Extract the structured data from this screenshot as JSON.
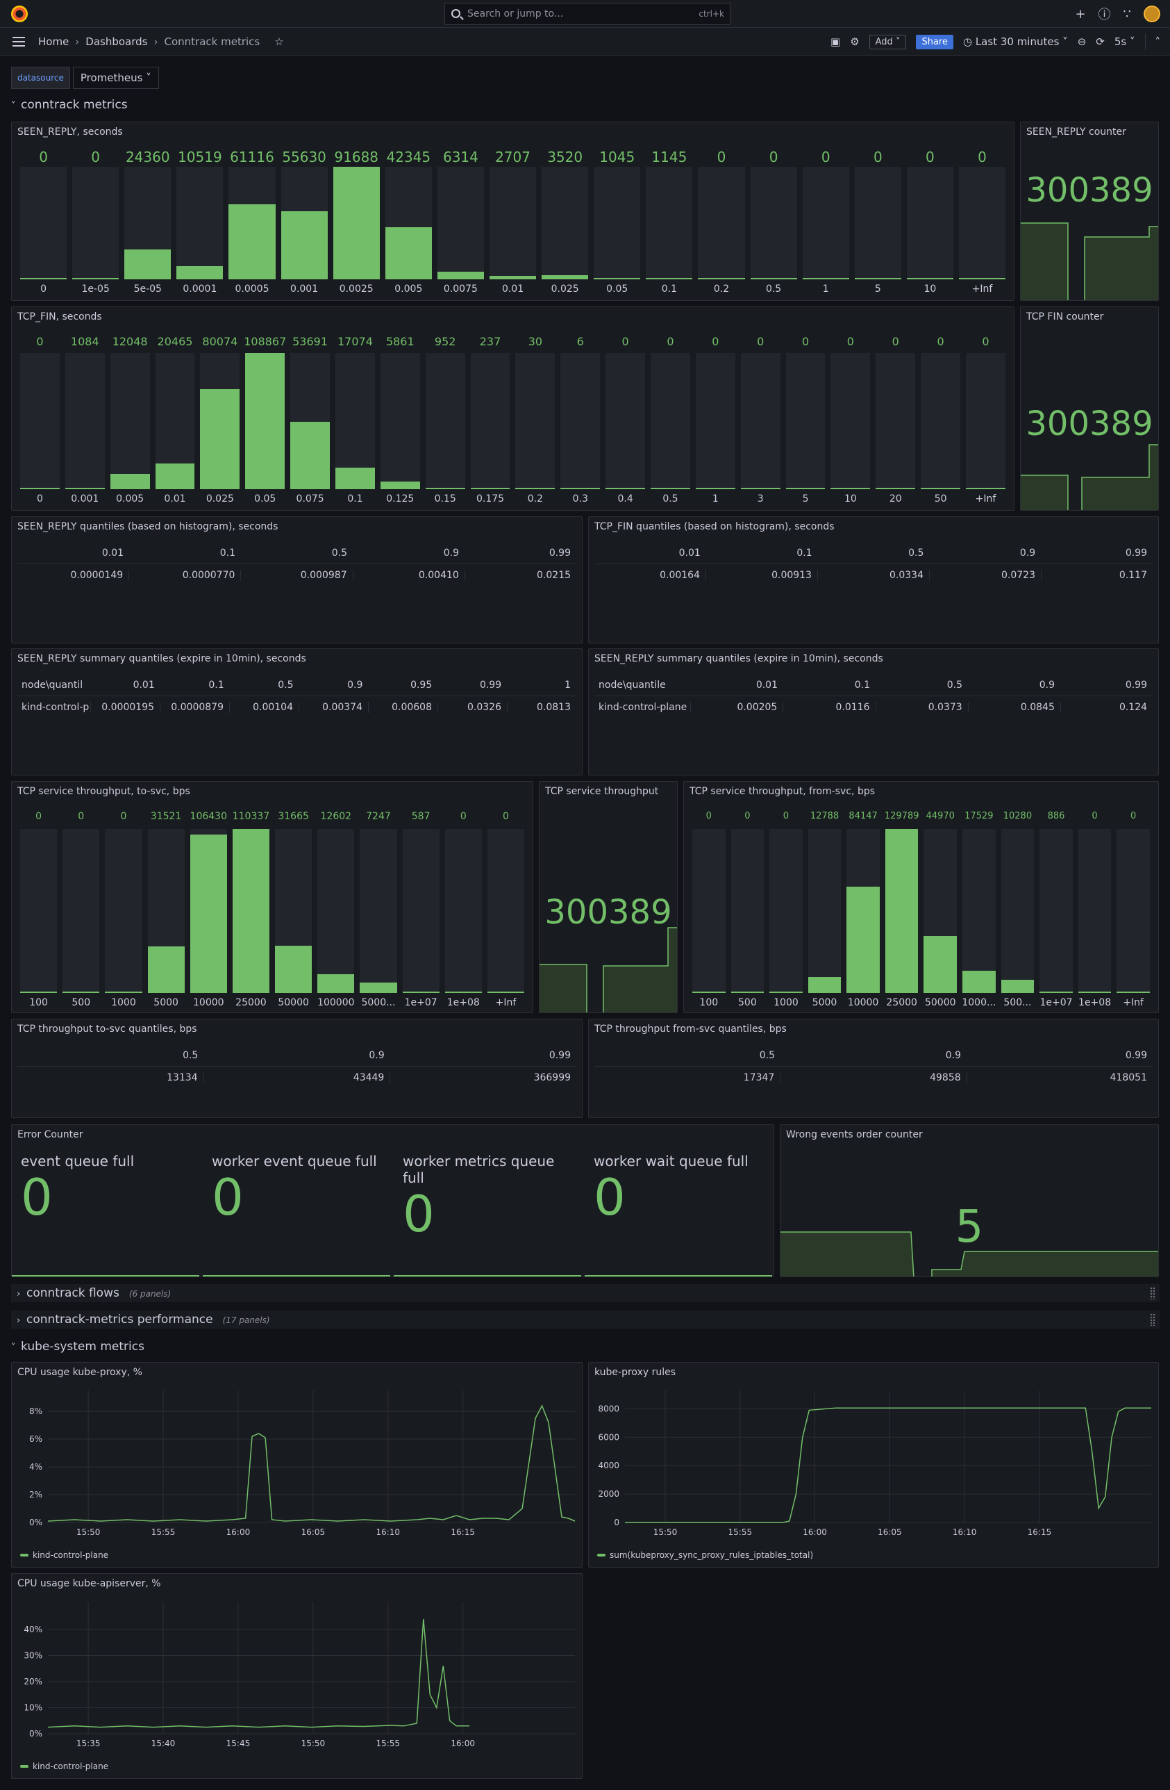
{
  "topbar": {
    "search_placeholder": "Search or jump to...",
    "search_shortcut": "ctrl+k",
    "plus_label": "+"
  },
  "nav": {
    "home": "Home",
    "dashboards": "Dashboards",
    "current": "Conntrack metrics",
    "add_label": "Add",
    "share_label": "Share",
    "time_range": "Last 30 minutes",
    "refresh": "5s"
  },
  "variables": {
    "label": "datasource",
    "value": "Prometheus"
  },
  "rows": {
    "conntrack": "conntrack metrics",
    "flows": "conntrack flows",
    "flows_count": "(6 panels)",
    "performance": "conntrack-metrics performance",
    "performance_count": "(17 panels)",
    "kube": "kube-system metrics"
  },
  "colors": {
    "accent": "#73bf69",
    "background": "#111217",
    "panel": "#181b1f",
    "link": "#6e9fff",
    "share": "#3d71d9"
  },
  "panels": {
    "seen_reply": {
      "title": "SEEN_REPLY, seconds"
    },
    "seen_reply_counter": {
      "title": "SEEN_REPLY counter",
      "value": "300389"
    },
    "tcp_fin": {
      "title": "TCP_FIN, seconds"
    },
    "tcp_fin_counter": {
      "title": "TCP FIN counter",
      "value": "300389"
    },
    "seen_reply_quantiles": {
      "title": "SEEN_REPLY quantiles (based on histogram), seconds",
      "headers": [
        "0.01",
        "0.1",
        "0.5",
        "0.9",
        "0.99"
      ],
      "values": [
        "0.0000149",
        "0.0000770",
        "0.000987",
        "0.00410",
        "0.0215"
      ]
    },
    "tcp_fin_quantiles": {
      "title": "TCP_FIN quantiles (based on histogram), seconds",
      "headers": [
        "0.01",
        "0.1",
        "0.5",
        "0.9",
        "0.99"
      ],
      "values": [
        "0.00164",
        "0.00913",
        "0.0334",
        "0.0723",
        "0.117"
      ]
    },
    "summary_a": {
      "title": "SEEN_REPLY summary quantiles (expire in 10min), seconds",
      "headers": [
        "node\\quantil",
        "0.01",
        "0.1",
        "0.5",
        "0.9",
        "0.95",
        "0.99",
        "1"
      ],
      "values": [
        "kind-control-p",
        "0.0000195",
        "0.0000879",
        "0.00104",
        "0.00374",
        "0.00608",
        "0.0326",
        "0.0813"
      ]
    },
    "summary_b": {
      "title": "SEEN_REPLY summary quantiles (expire in 10min), seconds",
      "headers": [
        "node\\quantile",
        "0.01",
        "0.1",
        "0.5",
        "0.9",
        "0.99"
      ],
      "values": [
        "kind-control-plane",
        "0.00205",
        "0.0116",
        "0.0373",
        "0.0845",
        "0.124"
      ]
    },
    "tcp_to_svc": {
      "title": "TCP service throughput, to-svc, bps"
    },
    "tcp_throughput": {
      "title": "TCP service throughput",
      "value": "300389"
    },
    "tcp_from_svc": {
      "title": "TCP service throughput, from-svc, bps"
    },
    "to_svc_quantiles": {
      "title": "TCP throughput to-svc quantiles, bps",
      "headers": [
        "0.5",
        "0.9",
        "0.99"
      ],
      "values": [
        "13134",
        "43449",
        "366999"
      ]
    },
    "from_svc_quantiles": {
      "title": "TCP throughput from-svc quantiles, bps",
      "headers": [
        "0.5",
        "0.9",
        "0.99"
      ],
      "values": [
        "17347",
        "49858",
        "418051"
      ]
    },
    "error_counter": {
      "title": "Error Counter",
      "items": [
        {
          "label": "event queue full",
          "value": "0"
        },
        {
          "label": "worker event queue full",
          "value": "0"
        },
        {
          "label": "worker metrics queue full",
          "value": "0"
        },
        {
          "label": "worker wait queue full",
          "value": "0"
        }
      ]
    },
    "wrong_order": {
      "title": "Wrong events order counter",
      "value": "5"
    },
    "cpu_proxy": {
      "title": "CPU usage kube-proxy, %",
      "legend": "kind-control-plane"
    },
    "proxy_rules": {
      "title": "kube-proxy rules",
      "legend": "sum(kubeproxy_sync_proxy_rules_iptables_total)"
    },
    "cpu_apiserver": {
      "title": "CPU usage kube-apiserver, %",
      "legend": "kind-control-plane"
    }
  },
  "chart_data": [
    {
      "type": "bar",
      "id": "seen_reply",
      "categories": [
        "0",
        "1e-05",
        "5e-05",
        "0.0001",
        "0.0005",
        "0.001",
        "0.0025",
        "0.005",
        "0.0075",
        "0.01",
        "0.025",
        "0.05",
        "0.1",
        "0.2",
        "0.5",
        "1",
        "5",
        "10",
        "+Inf"
      ],
      "values": [
        0,
        0,
        24360,
        10519,
        61116,
        55630,
        91688,
        42345,
        6314,
        2707,
        3520,
        1045,
        1145,
        0,
        0,
        0,
        0,
        0,
        0
      ]
    },
    {
      "type": "bar",
      "id": "tcp_fin",
      "categories": [
        "0",
        "0.001",
        "0.005",
        "0.01",
        "0.025",
        "0.05",
        "0.075",
        "0.1",
        "0.125",
        "0.15",
        "0.175",
        "0.2",
        "0.3",
        "0.4",
        "0.5",
        "1",
        "3",
        "5",
        "10",
        "20",
        "50",
        "+Inf"
      ],
      "values": [
        0,
        1084,
        12048,
        20465,
        80074,
        108867,
        53691,
        17074,
        5861,
        952,
        237,
        30,
        6,
        0,
        0,
        0,
        0,
        0,
        0,
        0,
        0,
        0
      ]
    },
    {
      "type": "bar",
      "id": "tcp_to_svc",
      "categories": [
        "100",
        "500",
        "1000",
        "5000",
        "10000",
        "25000",
        "50000",
        "100000",
        "5000...",
        "1e+07",
        "1e+08",
        "+Inf"
      ],
      "values": [
        0,
        0,
        0,
        31521,
        106430,
        110337,
        31665,
        12602,
        7247,
        587,
        0,
        0
      ]
    },
    {
      "type": "bar",
      "id": "tcp_from_svc",
      "categories": [
        "100",
        "500",
        "1000",
        "5000",
        "10000",
        "25000",
        "50000",
        "1000...",
        "500...",
        "1e+07",
        "1e+08",
        "+Inf"
      ],
      "values": [
        0,
        0,
        0,
        12788,
        84147,
        129789,
        44970,
        17529,
        10280,
        886,
        0,
        0
      ]
    },
    {
      "type": "line",
      "id": "cpu_proxy",
      "x_ticks": [
        "15:50",
        "15:55",
        "16:00",
        "16:05",
        "16:10",
        "16:15"
      ],
      "y_ticks": [
        "0%",
        "2%",
        "4%",
        "6%",
        "8%"
      ],
      "ylim": [
        0,
        9
      ],
      "x": [
        0,
        2,
        4,
        6,
        8,
        10,
        12,
        14,
        15,
        15.5,
        16,
        16.5,
        17,
        18,
        20,
        22,
        24,
        26,
        28,
        29,
        30,
        31,
        32,
        33,
        34,
        35,
        36,
        37,
        37.5,
        38,
        39,
        39.5,
        40
      ],
      "y": [
        0.1,
        0.2,
        0.1,
        0.2,
        0.1,
        0.2,
        0.1,
        0.2,
        0.3,
        6.2,
        6.4,
        6.1,
        0.2,
        0.1,
        0.2,
        0.1,
        0.2,
        0.1,
        0.2,
        0.3,
        0.2,
        0.5,
        0.2,
        0.3,
        0.3,
        0.2,
        1.0,
        7.5,
        8.4,
        7.2,
        0.4,
        0.3,
        0.1
      ]
    },
    {
      "type": "line",
      "id": "proxy_rules",
      "x_ticks": [
        "15:50",
        "15:55",
        "16:00",
        "16:05",
        "16:10",
        "16:15"
      ],
      "y_ticks": [
        "0",
        "2000",
        "4000",
        "6000",
        "8000"
      ],
      "ylim": [
        0,
        8800
      ],
      "x": [
        0,
        5,
        10,
        12,
        12.5,
        13,
        13.5,
        14,
        16,
        20,
        25,
        30,
        34,
        35,
        35.5,
        36,
        36.5,
        37,
        37.5,
        38,
        40
      ],
      "y": [
        0,
        0,
        0,
        0,
        100,
        2000,
        6000,
        7900,
        8050,
        8050,
        8050,
        8050,
        8050,
        8050,
        5000,
        1000,
        1800,
        6000,
        7800,
        8050,
        8050
      ]
    },
    {
      "type": "line",
      "id": "cpu_apiserver",
      "x_ticks": [
        "15:35",
        "15:40",
        "15:45",
        "15:50",
        "15:55",
        "16:00"
      ],
      "y_ticks": [
        "0%",
        "10%",
        "20%",
        "30%",
        "40%"
      ],
      "ylim": [
        0,
        48
      ],
      "x": [
        0,
        2,
        4,
        6,
        8,
        10,
        12,
        14,
        16,
        18,
        20,
        22,
        24,
        26,
        27,
        28,
        28.5,
        29,
        29.5,
        30,
        30.5,
        31,
        31.5,
        32
      ],
      "y": [
        2.5,
        3,
        2.5,
        3,
        2.5,
        3,
        2.5,
        3,
        2.5,
        3,
        2.5,
        3,
        2.8,
        3.2,
        3,
        4,
        44,
        15,
        10,
        26,
        5,
        3,
        3,
        3
      ]
    }
  ]
}
